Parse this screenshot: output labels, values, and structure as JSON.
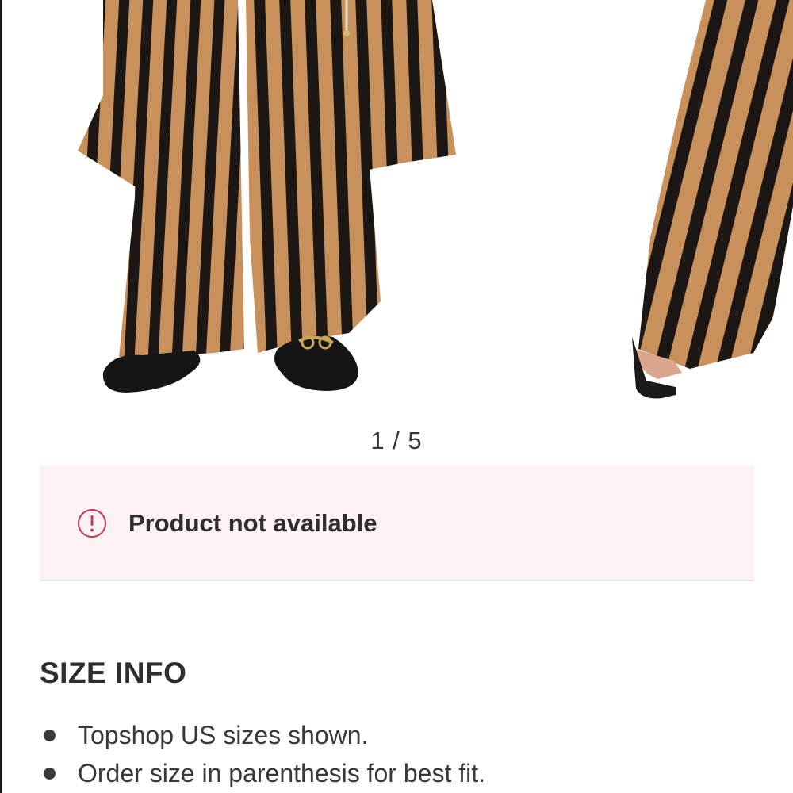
{
  "gallery": {
    "image_alt": "Striped wide-leg trousers with black loafers and sandals",
    "stripe_colors": [
      "#c8915b",
      "#1c1714"
    ],
    "pager_text": "1 / 5"
  },
  "alert": {
    "icon": "exclamation-circle-icon",
    "icon_color": "#d0305a",
    "message": "Product not available",
    "background": "#fcf1f3"
  },
  "size_info": {
    "heading": "SIZE INFO",
    "items": [
      "Topshop US sizes shown.",
      "Order size in parenthesis for best fit."
    ]
  }
}
